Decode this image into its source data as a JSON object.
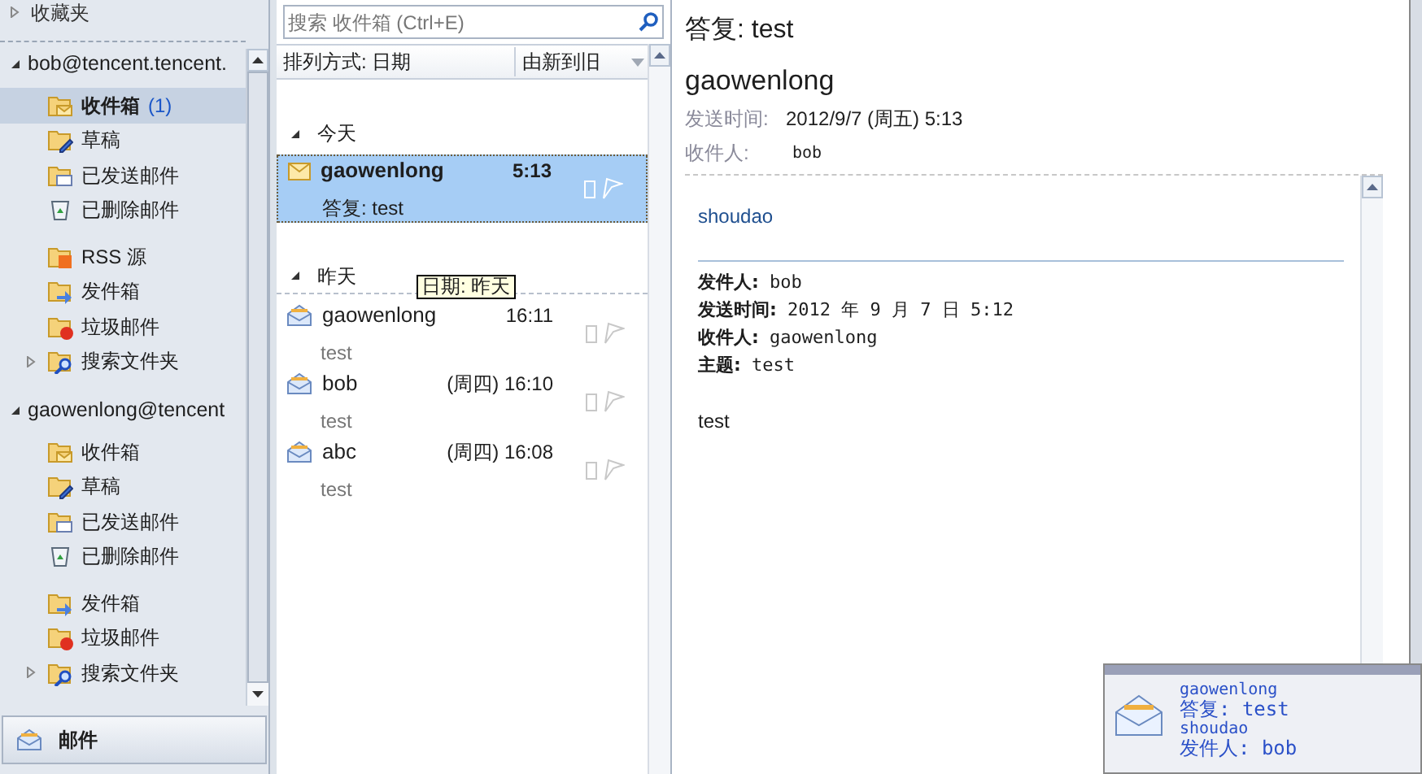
{
  "favorites": {
    "label": "收藏夹",
    "expanded": false
  },
  "accounts": [
    {
      "name": "bob@tencent.tencent.",
      "expanded": true,
      "sections": [
        {
          "folders": [
            {
              "kind": "inbox",
              "label": "收件箱",
              "count": "(1)",
              "selected": true
            },
            {
              "kind": "drafts",
              "label": "草稿",
              "selected": false
            },
            {
              "kind": "sent",
              "label": "已发送邮件",
              "selected": false
            },
            {
              "kind": "deleted",
              "label": "已删除邮件",
              "selected": false
            }
          ]
        },
        {
          "folders": [
            {
              "kind": "rss",
              "label": "RSS 源",
              "selected": false
            },
            {
              "kind": "outbox",
              "label": "发件箱",
              "selected": false
            },
            {
              "kind": "junk",
              "label": "垃圾邮件",
              "selected": false
            },
            {
              "kind": "search",
              "label": "搜索文件夹",
              "selected": false,
              "expanded": false
            }
          ]
        }
      ]
    },
    {
      "name": "gaowenlong@tencent",
      "expanded": true,
      "sections": [
        {
          "folders": [
            {
              "kind": "inbox",
              "label": "收件箱",
              "selected": false
            },
            {
              "kind": "drafts",
              "label": "草稿",
              "selected": false
            },
            {
              "kind": "sent",
              "label": "已发送邮件",
              "selected": false
            },
            {
              "kind": "deleted",
              "label": "已删除邮件",
              "selected": false
            }
          ]
        },
        {
          "folders": [
            {
              "kind": "outbox",
              "label": "发件箱",
              "selected": false
            },
            {
              "kind": "junk",
              "label": "垃圾邮件",
              "selected": false
            },
            {
              "kind": "search",
              "label": "搜索文件夹",
              "selected": false,
              "expanded": false
            }
          ]
        }
      ]
    }
  ],
  "nav_button": {
    "label": "邮件"
  },
  "search": {
    "placeholder": "搜索 收件箱 (Ctrl+E)"
  },
  "sort": {
    "by": "排列方式: 日期",
    "order": "由新到旧"
  },
  "groups": [
    {
      "label": "今天",
      "expanded": true,
      "messages": [
        {
          "from": "gaowenlong",
          "time": "5:13",
          "subject": "答复: test",
          "unread": true,
          "selected": true
        }
      ]
    },
    {
      "label": "昨天",
      "expanded": true,
      "tooltip": "日期: 昨天",
      "messages": [
        {
          "from": "gaowenlong",
          "time": "16:11",
          "subject": "test",
          "unread": false,
          "selected": false
        },
        {
          "from": "bob",
          "time": "(周四) 16:10",
          "subject": "test",
          "unread": false,
          "selected": false
        },
        {
          "from": "abc",
          "time": "(周四) 16:08",
          "subject": "test",
          "unread": false,
          "selected": false
        }
      ]
    }
  ],
  "reading": {
    "subject": "答复: test",
    "sender": "gaowenlong",
    "fields": [
      {
        "label": "发送时间:",
        "value": "2012/9/7 (周五) 5:13"
      },
      {
        "label": "收件人:",
        "value": "bob"
      }
    ],
    "body_first": "shoudao",
    "quoted": [
      {
        "label": "发件人:",
        "value": "bob"
      },
      {
        "label": "发送时间:",
        "value": "2012 年 9 月 7 日 5:12"
      },
      {
        "label": "收件人:",
        "value": "gaowenlong"
      },
      {
        "label": "主题:",
        "value": "test"
      }
    ],
    "body_last": "test"
  },
  "alert": {
    "from": "gaowenlong",
    "subject": "答复: test",
    "preview": "shoudao",
    "line": "发件人: bob"
  }
}
